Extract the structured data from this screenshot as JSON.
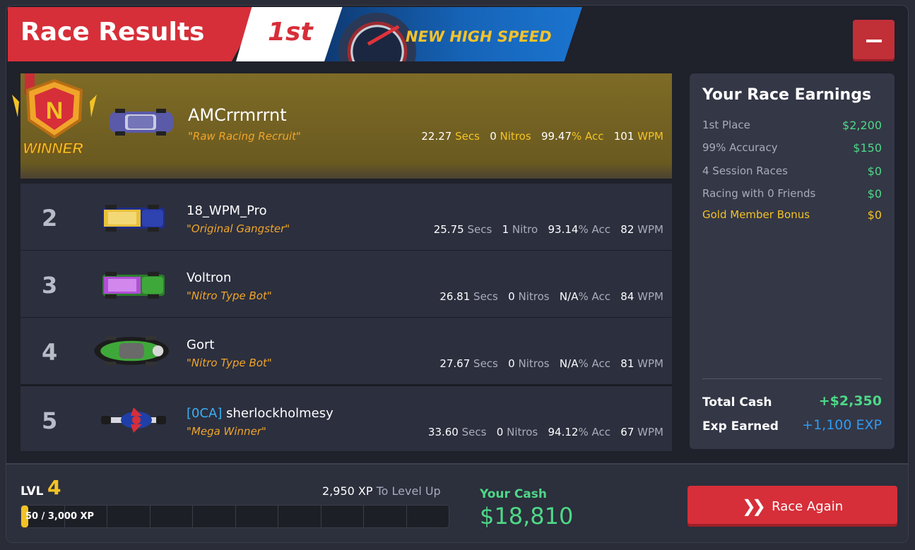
{
  "header": {
    "title": "Race Results",
    "place": "1st",
    "banner": "NEW HIGH SPEED"
  },
  "winner": {
    "badge_text": "WINNER",
    "badge_letter": "N",
    "name": "AMCrrmrrnt",
    "title": "\"Raw Racing Recruit\"",
    "secs": "22.27",
    "nitros": "0",
    "acc": "99.47",
    "wpm": "101"
  },
  "racers": [
    {
      "rank": "2",
      "team": "",
      "name": "18_WPM_Pro",
      "title": "\"Original Gangster\"",
      "secs": "25.75",
      "nitros": "1",
      "nitro_label": "Nitro",
      "acc": "93.14",
      "wpm": "82",
      "car_color": "#e8c13a"
    },
    {
      "rank": "3",
      "team": "",
      "name": "Voltron",
      "title": "\"Nitro Type Bot\"",
      "secs": "26.81",
      "nitros": "0",
      "nitro_label": "Nitros",
      "acc": "N/A",
      "wpm": "84",
      "car_color": "#b04fd6"
    },
    {
      "rank": "4",
      "team": "",
      "name": "Gort",
      "title": "\"Nitro Type Bot\"",
      "secs": "27.67",
      "nitros": "0",
      "nitro_label": "Nitros",
      "acc": "N/A",
      "wpm": "81",
      "car_color": "#3fa83a"
    },
    {
      "rank": "5",
      "team": "[0CA]",
      "name": "sherlockholmesy",
      "title": "\"Mega Winner\"",
      "secs": "33.60",
      "nitros": "0",
      "nitro_label": "Nitros",
      "acc": "94.12",
      "wpm": "67",
      "car_color": "#1f3fa8"
    }
  ],
  "labels": {
    "secs": "Secs",
    "nitros": "Nitros",
    "acc": "% Acc",
    "wpm": "WPM"
  },
  "earnings": {
    "title": "Your Race Earnings",
    "lines": [
      {
        "label": "1st Place",
        "amount": "$2,200"
      },
      {
        "label": "99% Accuracy",
        "amount": "$150"
      },
      {
        "label": "4 Session Races",
        "amount": "$0"
      },
      {
        "label": "Racing with 0 Friends",
        "amount": "$0"
      },
      {
        "label": "Gold Member Bonus",
        "amount": "$0"
      }
    ],
    "total_cash_label": "Total Cash",
    "total_cash": "+$2,350",
    "exp_label": "Exp Earned",
    "exp": "+1,100 EXP"
  },
  "footer": {
    "lvl_label": "LVL",
    "lvl": "4",
    "xp_to_level_value": "2,950 XP",
    "xp_to_level_label": "To Level Up",
    "xp_progress_text": "50 / 3,000 XP",
    "xp_progress_fraction": 0.0167,
    "cash_label": "Your Cash",
    "cash_value": "$18,810",
    "race_again": "Race Again"
  },
  "colors": {
    "accent_red": "#d62f39",
    "gold": "#f3c325",
    "green": "#4ed887",
    "blue": "#2f9bf0"
  }
}
